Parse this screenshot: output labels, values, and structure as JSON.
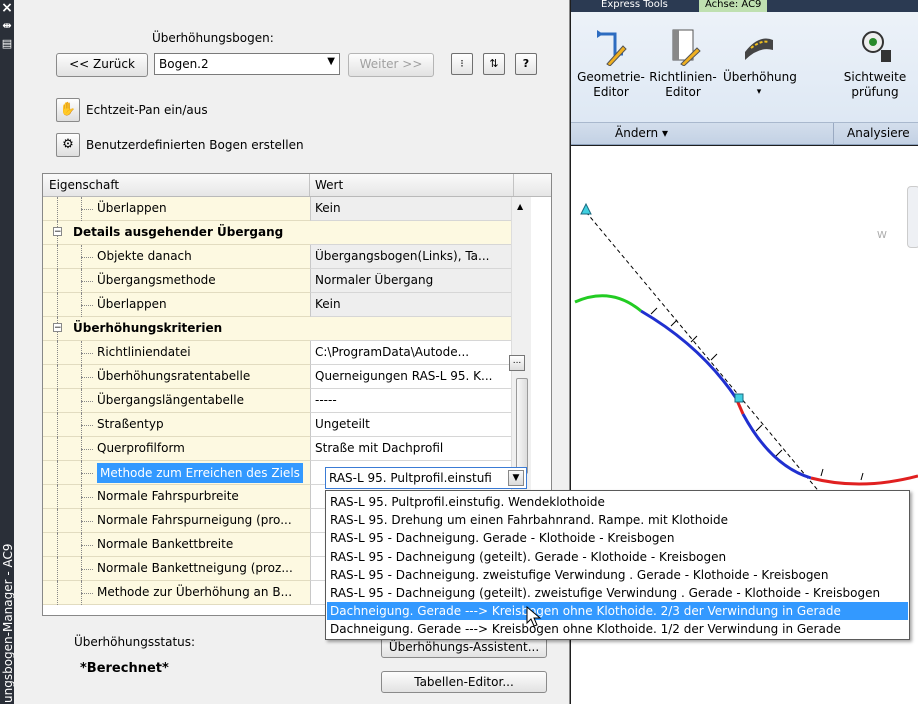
{
  "window": {
    "vertical_title": "ungsbogen-Manager - AC9",
    "close_glyph": "×"
  },
  "header": {
    "label": "Überhöhungsbogen:",
    "back_button": "<< Zurück",
    "next_button": "Weiter >>",
    "combo_value": "Bogen.2",
    "help_glyph": "?"
  },
  "tools": {
    "pan_label": "Echtzeit-Pan ein/aus",
    "custom_curve_label": "Benutzerdefinierten Bogen erstellen"
  },
  "grid": {
    "col_property": "Eigenschaft",
    "col_value": "Wert",
    "rows": [
      {
        "label": "Überlappen",
        "value": "Kein",
        "indent": 2,
        "bold": false,
        "shade": true
      },
      {
        "label": "Details ausgehender Übergang",
        "value": "",
        "indent": 1,
        "bold": true,
        "shade": false
      },
      {
        "label": "Objekte danach",
        "value": "Übergangsbogen(Links), Ta...",
        "indent": 2,
        "bold": false,
        "shade": true
      },
      {
        "label": "Übergangsmethode",
        "value": "Normaler Übergang",
        "indent": 2,
        "bold": false,
        "shade": true
      },
      {
        "label": "Überlappen",
        "value": "Kein",
        "indent": 2,
        "bold": false,
        "shade": true
      },
      {
        "label": "Überhöhungskriterien",
        "value": "",
        "indent": 1,
        "bold": true,
        "shade": false
      },
      {
        "label": "Richtliniendatei",
        "value": "C:\\ProgramData\\Autode...",
        "indent": 2,
        "bold": false,
        "shade": false
      },
      {
        "label": "Überhöhungsratentabelle",
        "value": "Querneigungen RAS-L 95. K...",
        "indent": 2,
        "bold": false,
        "shade": false
      },
      {
        "label": "Übergangslängentabelle",
        "value": "-----",
        "indent": 2,
        "bold": false,
        "shade": false
      },
      {
        "label": "Straßentyp",
        "value": "Ungeteilt",
        "indent": 2,
        "bold": false,
        "shade": false
      },
      {
        "label": "Querprofilform",
        "value": "Straße mit Dachprofil",
        "indent": 2,
        "bold": false,
        "shade": false
      },
      {
        "label": "Methode zum Erreichen des Ziels",
        "value": "",
        "indent": 2,
        "bold": false,
        "shade": false
      },
      {
        "label": "Normale Fahrspurbreite",
        "value": "",
        "indent": 2,
        "bold": false,
        "shade": false
      },
      {
        "label": "Normale Fahrspurneigung (pro...",
        "value": "",
        "indent": 2,
        "bold": false,
        "shade": false
      },
      {
        "label": "Normale Bankettbreite",
        "value": "",
        "indent": 2,
        "bold": false,
        "shade": false
      },
      {
        "label": "Normale Bankettneigung (proz...",
        "value": "",
        "indent": 2,
        "bold": false,
        "shade": false
      },
      {
        "label": "Methode zur Überhöhung an B...",
        "value": "",
        "indent": 2,
        "bold": false,
        "shade": false
      }
    ],
    "selected_combo_value": "RAS-L 95. Pultprofil.einstufi",
    "browse_glyph": "..."
  },
  "dropdown_options": [
    "RAS-L 95. Pultprofil.einstufig. Wendeklothoide",
    "RAS-L 95. Drehung um einen Fahrbahnrand. Rampe. mit Klothoide",
    "RAS-L 95 - Dachneigung. Gerade - Klothoide - Kreisbogen",
    "RAS-L 95 - Dachneigung (geteilt). Gerade - Klothoide - Kreisbogen",
    "RAS-L 95 - Dachneigung. zweistufige Verwindung . Gerade - Klothoide - Kreisbogen",
    "RAS-L 95 - Dachneigung (geteilt). zweistufige Verwindung . Gerade - Klothoide - Kreisbogen",
    "Dachneigung. Gerade ---> Kreisbogen ohne Klothoide. 2/3 der Verwindung in Gerade",
    "Dachneigung. Gerade ---> Kreisbogen ohne Klothoide. 1/2 der Verwindung in Gerade"
  ],
  "dropdown_highlight_index": 6,
  "status": {
    "label": "Überhöhungsstatus:",
    "value": "*Berechnet*",
    "assistant_button": "Überhöhungs-Assistent...",
    "table_editor_button": "Tabellen-Editor..."
  },
  "ribbon": {
    "tab_express": "Express Tools",
    "tab_active": "Achse: AC9",
    "buttons": [
      {
        "label1": "Geometrie-",
        "label2": "Editor"
      },
      {
        "label1": "Richtlinien-",
        "label2": "Editor"
      },
      {
        "label1": "Überhöhung",
        "label2": "▾"
      },
      {
        "label1": "Sichtweite",
        "label2": "prüfung"
      }
    ],
    "group_change": "Ändern ▾",
    "group_analyze": "Analysiere"
  },
  "canvas": {
    "compass_w": "W"
  }
}
